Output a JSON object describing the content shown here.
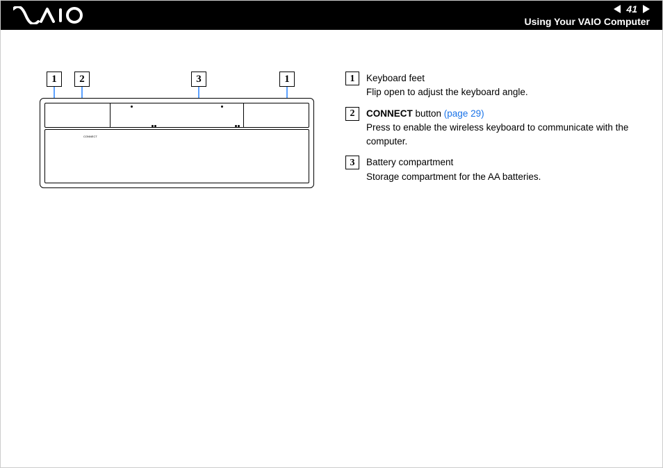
{
  "header": {
    "page_number": "41",
    "section_title": "Using Your VAIO Computer"
  },
  "diagram": {
    "callouts": [
      "1",
      "2",
      "3",
      "1"
    ],
    "connect_label": "CONNECT"
  },
  "legend": [
    {
      "num": "1",
      "title": "Keyboard feet",
      "desc": "Flip open to adjust the keyboard angle."
    },
    {
      "num": "2",
      "title_bold": "CONNECT",
      "title_rest": " button ",
      "link": "(page 29)",
      "desc": "Press to enable the wireless keyboard to communicate with the computer."
    },
    {
      "num": "3",
      "title": "Battery compartment",
      "desc": "Storage compartment for the AA batteries."
    }
  ]
}
